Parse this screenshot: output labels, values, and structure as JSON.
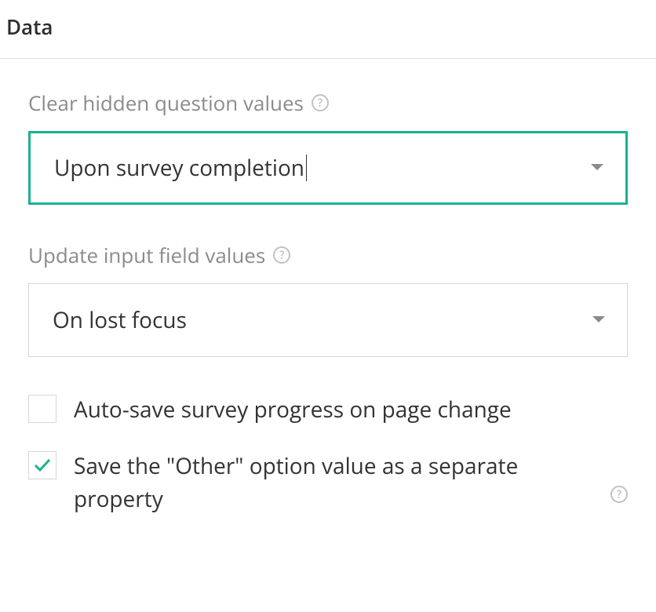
{
  "section": {
    "title": "Data"
  },
  "fields": {
    "clear_hidden": {
      "label": "Clear hidden question values",
      "value": "Upon survey completion"
    },
    "update_input": {
      "label": "Update input field values",
      "value": "On lost focus"
    }
  },
  "checkboxes": {
    "autosave": {
      "label": "Auto-save survey progress on page change",
      "checked": false
    },
    "save_other": {
      "label": "Save the \"Other\" option value as a separate property",
      "checked": true
    }
  }
}
